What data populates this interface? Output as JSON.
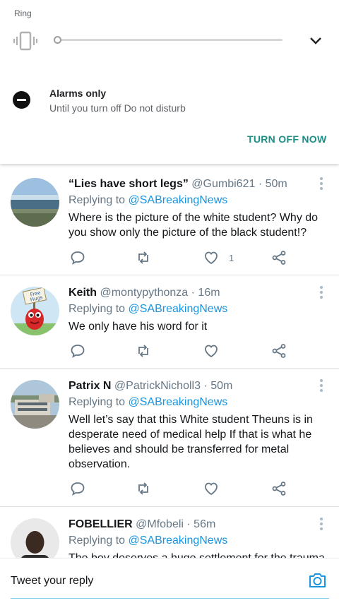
{
  "sound_panel": {
    "mode_label": "Ring",
    "slider_level": 0.0,
    "expand_icon": "chevron-down-icon",
    "vibrate_icon": "vibrate-icon"
  },
  "dnd": {
    "icon": "do-not-disturb-icon",
    "title": "Alarms only",
    "subtitle": "Until you turn off Do not disturb",
    "action": "TURN OFF NOW",
    "accent_color": "#1a8f86"
  },
  "tweets": [
    {
      "name": "“Lies have short legs”",
      "handle": "@Gumbi621",
      "time": "· 50m",
      "replying_prefix": "Replying to",
      "replying_to": "@SABreakingNews",
      "text": "Where is the picture of the white student? Why do you show only the picture of the black student!?",
      "likes": "1",
      "avatar": "beach-photo"
    },
    {
      "name": "Keith",
      "handle": "@montypythonza",
      "time": "· 16m",
      "replying_prefix": "Replying to",
      "replying_to": "@SABreakingNews",
      "text": "We only have his word for it",
      "likes": "",
      "avatar": "free-hugs-monster",
      "avatar_sign": "Free Hugs"
    },
    {
      "name": "Patrix N",
      "handle": "@PatrickNicholl3",
      "time": "· 50m",
      "replying_prefix": "Replying to",
      "replying_to": "@SABreakingNews",
      "text": "Well let’s say that this White student Theuns is in desperate need of medical help If that is what he believes and should be transferred for metal observation.",
      "likes": "",
      "avatar": "building-photo"
    },
    {
      "name": "FOBELLIER",
      "handle": "@Mfobeli",
      "time": "· 56m",
      "replying_prefix": "Replying to",
      "replying_to": "@SABreakingNews",
      "text": "The boy deserves a huge settlement for the trauma",
      "likes": "",
      "avatar": "man-photo"
    }
  ],
  "reply_bar": {
    "placeholder": "Tweet your reply",
    "camera_icon": "camera-icon",
    "accent_color": "#1b95e0"
  }
}
